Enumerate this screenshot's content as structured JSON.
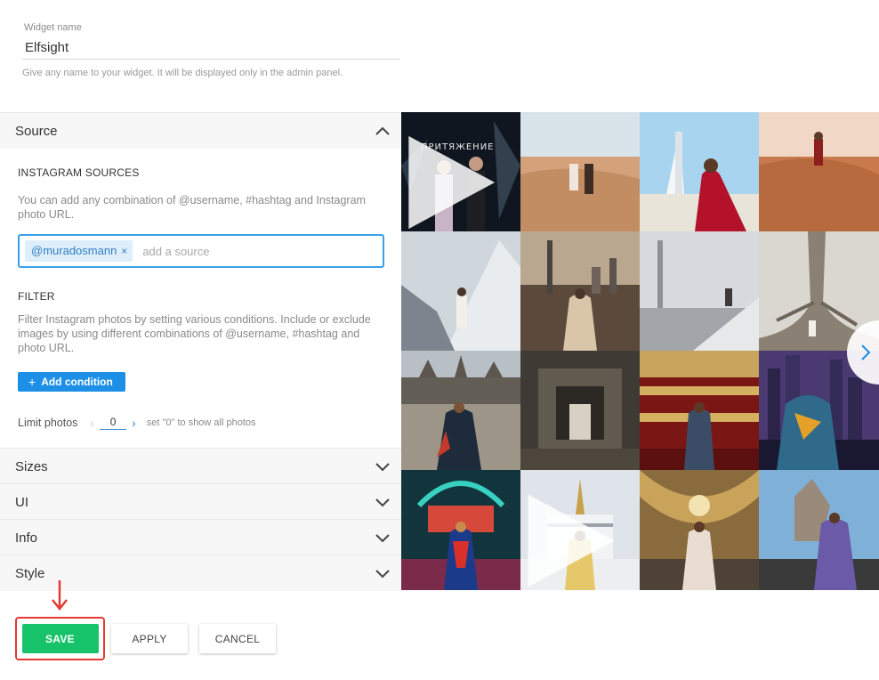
{
  "widget": {
    "label": "Widget name",
    "value": "Elfsight",
    "help": "Give any name to your widget. It will be displayed only in the admin panel."
  },
  "panels": {
    "source": "Source",
    "sizes": "Sizes",
    "ui": "UI",
    "info": "Info",
    "style": "Style"
  },
  "source": {
    "instagram_title": "INSTAGRAM SOURCES",
    "instagram_help": "You can add any combination of @username, #hashtag and Instagram photo URL.",
    "tag": "@muradosmann",
    "tag_remove": "×",
    "placeholder": "add a source",
    "filter_title": "FILTER",
    "filter_help": "Filter Instagram photos by setting various conditions. Include or exclude images by using different combinations of @username, #hashtag and photo URL.",
    "add_condition": "Add condition",
    "add_condition_plus": "+",
    "limit_label": "Limit photos",
    "limit_value": "0",
    "limit_help": "set \"0\" to show all photos"
  },
  "buttons": {
    "save": "SAVE",
    "apply": "APPLY",
    "cancel": "CANCEL"
  },
  "gallery": {
    "poster_text": "ПРИТЯЖЕНИЕ",
    "tiles": 16
  },
  "colors": {
    "accent_blue": "#1e8fe6",
    "save_green": "#17c36a",
    "highlight_red": "#e53935"
  }
}
